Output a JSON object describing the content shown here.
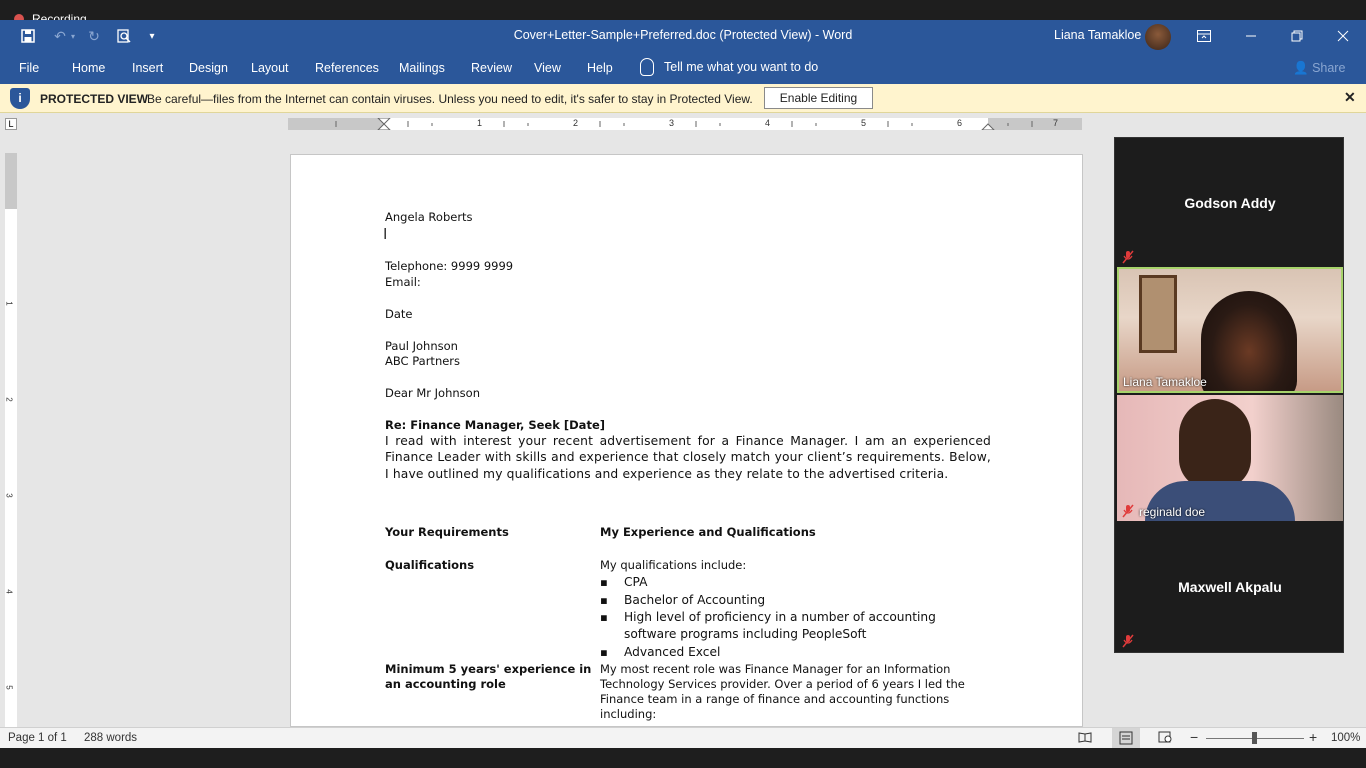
{
  "recording": {
    "label": "Recording"
  },
  "titlebar": {
    "document_title": "Cover+Letter-Sample+Preferred.doc (Protected View)  -  Word",
    "user_name": "Liana Tamakloe"
  },
  "tabs": [
    "File",
    "Home",
    "Insert",
    "Design",
    "Layout",
    "References",
    "Mailings",
    "Review",
    "View",
    "Help"
  ],
  "tell_me": "Tell me what you want to do",
  "share": "Share",
  "protected_view": {
    "title": "PROTECTED VIEW",
    "message": "Be careful—files from the Internet can contain viruses. Unless you need to edit, it's safer to stay in Protected View.",
    "button": "Enable Editing"
  },
  "ruler": {
    "numbers": [
      "1",
      "2",
      "3",
      "4",
      "5",
      "6",
      "7"
    ],
    "vnumbers": [
      "1",
      "2",
      "3",
      "4",
      "5"
    ]
  },
  "letter": {
    "name": "Angela Roberts",
    "telephone": "Telephone:   9999 9999",
    "email": "Email:",
    "date": "Date",
    "recipient_name": "Paul Johnson",
    "recipient_company": "ABC Partners",
    "salutation": "Dear Mr Johnson",
    "subject": "Re: Finance Manager, Seek [Date]",
    "intro": "I read with interest your recent advertisement for a Finance Manager. I am an experienced Finance Leader with skills and experience that closely match your client’s requirements. Below, I have outlined my qualifications and experience as they relate to the advertised criteria.",
    "col_left_header": "Your Requirements",
    "col_right_header": "My Experience and Qualifications",
    "req1": "Qualifications",
    "req1_intro": "My qualifications include:",
    "req1_bullets": [
      "CPA",
      "Bachelor of Accounting",
      "High level of proficiency in a number of accounting",
      "software programs including PeopleSoft",
      "Advanced Excel"
    ],
    "req2_lines": [
      "Minimum 5 years' experience in",
      "an accounting role"
    ],
    "req2_text_lines": [
      "My most recent role was Finance Manager for an Information",
      "Technology Services provider. Over a period of 6 years I led the",
      "Finance team in a range of finance and accounting functions",
      "including:"
    ]
  },
  "participants": [
    {
      "name": "Godson Addy",
      "video": false,
      "muted": true
    },
    {
      "name": "Liana Tamakloe",
      "video": true,
      "muted": false,
      "active": true
    },
    {
      "name": "reginald doe",
      "video": true,
      "muted": true
    },
    {
      "name": "Maxwell Akpalu",
      "video": false,
      "muted": true
    }
  ],
  "status": {
    "page": "Page 1 of 1",
    "words": "288 words",
    "zoom": "100%",
    "zoom_minus": "−",
    "zoom_plus": "+"
  },
  "icons": {
    "save": "save-icon",
    "undo": "undo-icon",
    "redo": "redo-icon",
    "print_preview": "print-preview-icon",
    "customize": "customize-qat-icon",
    "ribbon_display": "ribbon-display-icon",
    "minimize": "minimize-icon",
    "restore": "restore-icon",
    "close": "close-icon",
    "lightbulb": "lightbulb-icon",
    "share": "share-icon",
    "shield": "shield-icon",
    "mic_off": "mic-off-icon",
    "read_mode": "read-mode-icon",
    "print_layout": "print-layout-icon",
    "web_layout": "web-layout-icon"
  },
  "colors": {
    "word_blue": "#2b579a",
    "message_bar": "#fff4ce",
    "active_speaker": "#a7d36b",
    "mic_off": "#e03b3b"
  }
}
